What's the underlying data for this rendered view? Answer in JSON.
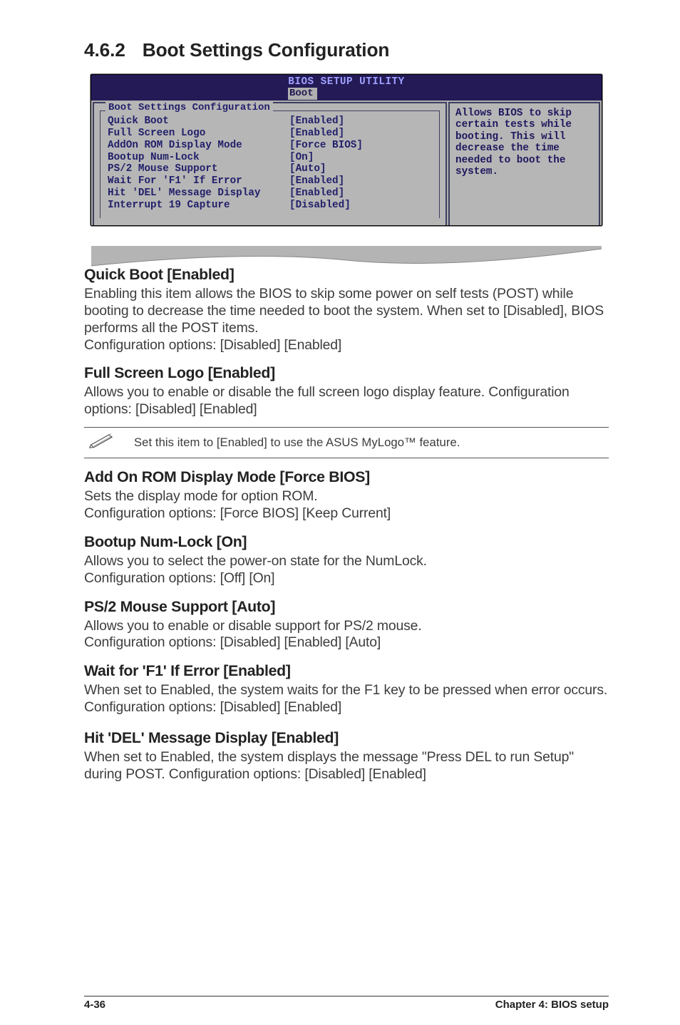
{
  "section": {
    "number": "4.6.2",
    "title": "Boot Settings Configuration"
  },
  "bios": {
    "utility_title": "BIOS SETUP UTILITY",
    "tab": "Boot",
    "panel_title": "Boot Settings Configuration",
    "help_text": "Allows BIOS to skip certain tests while booting. This will decrease the time needed to boot the system.",
    "items": [
      {
        "name": "Quick Boot",
        "value": "[Enabled]"
      },
      {
        "name": "Full Screen Logo",
        "value": "[Enabled]"
      },
      {
        "name": "AddOn ROM Display Mode",
        "value": "[Force BIOS]"
      },
      {
        "name": "Bootup Num-Lock",
        "value": "[On]"
      },
      {
        "name": "PS/2 Mouse Support",
        "value": "[Auto]"
      },
      {
        "name": "Wait For 'F1' If Error",
        "value": "[Enabled]"
      },
      {
        "name": "Hit 'DEL' Message Display",
        "value": "[Enabled]"
      },
      {
        "name": "Interrupt 19 Capture",
        "value": "[Disabled]"
      }
    ]
  },
  "subsections": {
    "quickboot": {
      "heading": "Quick Boot [Enabled]",
      "body1": "Enabling this item allows the BIOS to skip some power on self tests (POST) while booting to decrease the time needed to boot the system. When set to [Disabled], BIOS performs all the POST items.",
      "body2": "Configuration options: [Disabled] [Enabled]"
    },
    "fullscreen": {
      "heading": "Full Screen Logo [Enabled]",
      "body1": "Allows you to enable or disable the full screen logo display feature. Configuration options: [Disabled] [Enabled]",
      "note": "Set this item to [Enabled] to use the ASUS MyLogo™ feature."
    },
    "addrom": {
      "heading": "Add On ROM Display Mode [Force BIOS]",
      "body1": "Sets the display mode for option ROM.",
      "body2": "Configuration options: [Force BIOS] [Keep Current]"
    },
    "numlock": {
      "heading": "Bootup Num-Lock [On]",
      "body1": "Allows you to select the power-on state for the NumLock.",
      "body2": "Configuration options: [Off] [On]"
    },
    "ps2": {
      "heading": "PS/2 Mouse Support [Auto]",
      "body1": "Allows you to enable or disable support for PS/2 mouse.",
      "body2": "Configuration options: [Disabled] [Enabled] [Auto]"
    },
    "waitf1": {
      "heading": "Wait for 'F1' If Error [Enabled]",
      "body1": "When set to Enabled, the system waits for the F1 key to be pressed when error occurs. Configuration options: [Disabled] [Enabled]"
    },
    "hitdel": {
      "heading": "Hit 'DEL' Message Display [Enabled]",
      "body1": "When set to Enabled, the system displays the message \"Press DEL to run Setup\" during POST. Configuration options: [Disabled] [Enabled]"
    }
  },
  "footer": {
    "left": "4-36",
    "right": "Chapter 4: BIOS setup"
  }
}
